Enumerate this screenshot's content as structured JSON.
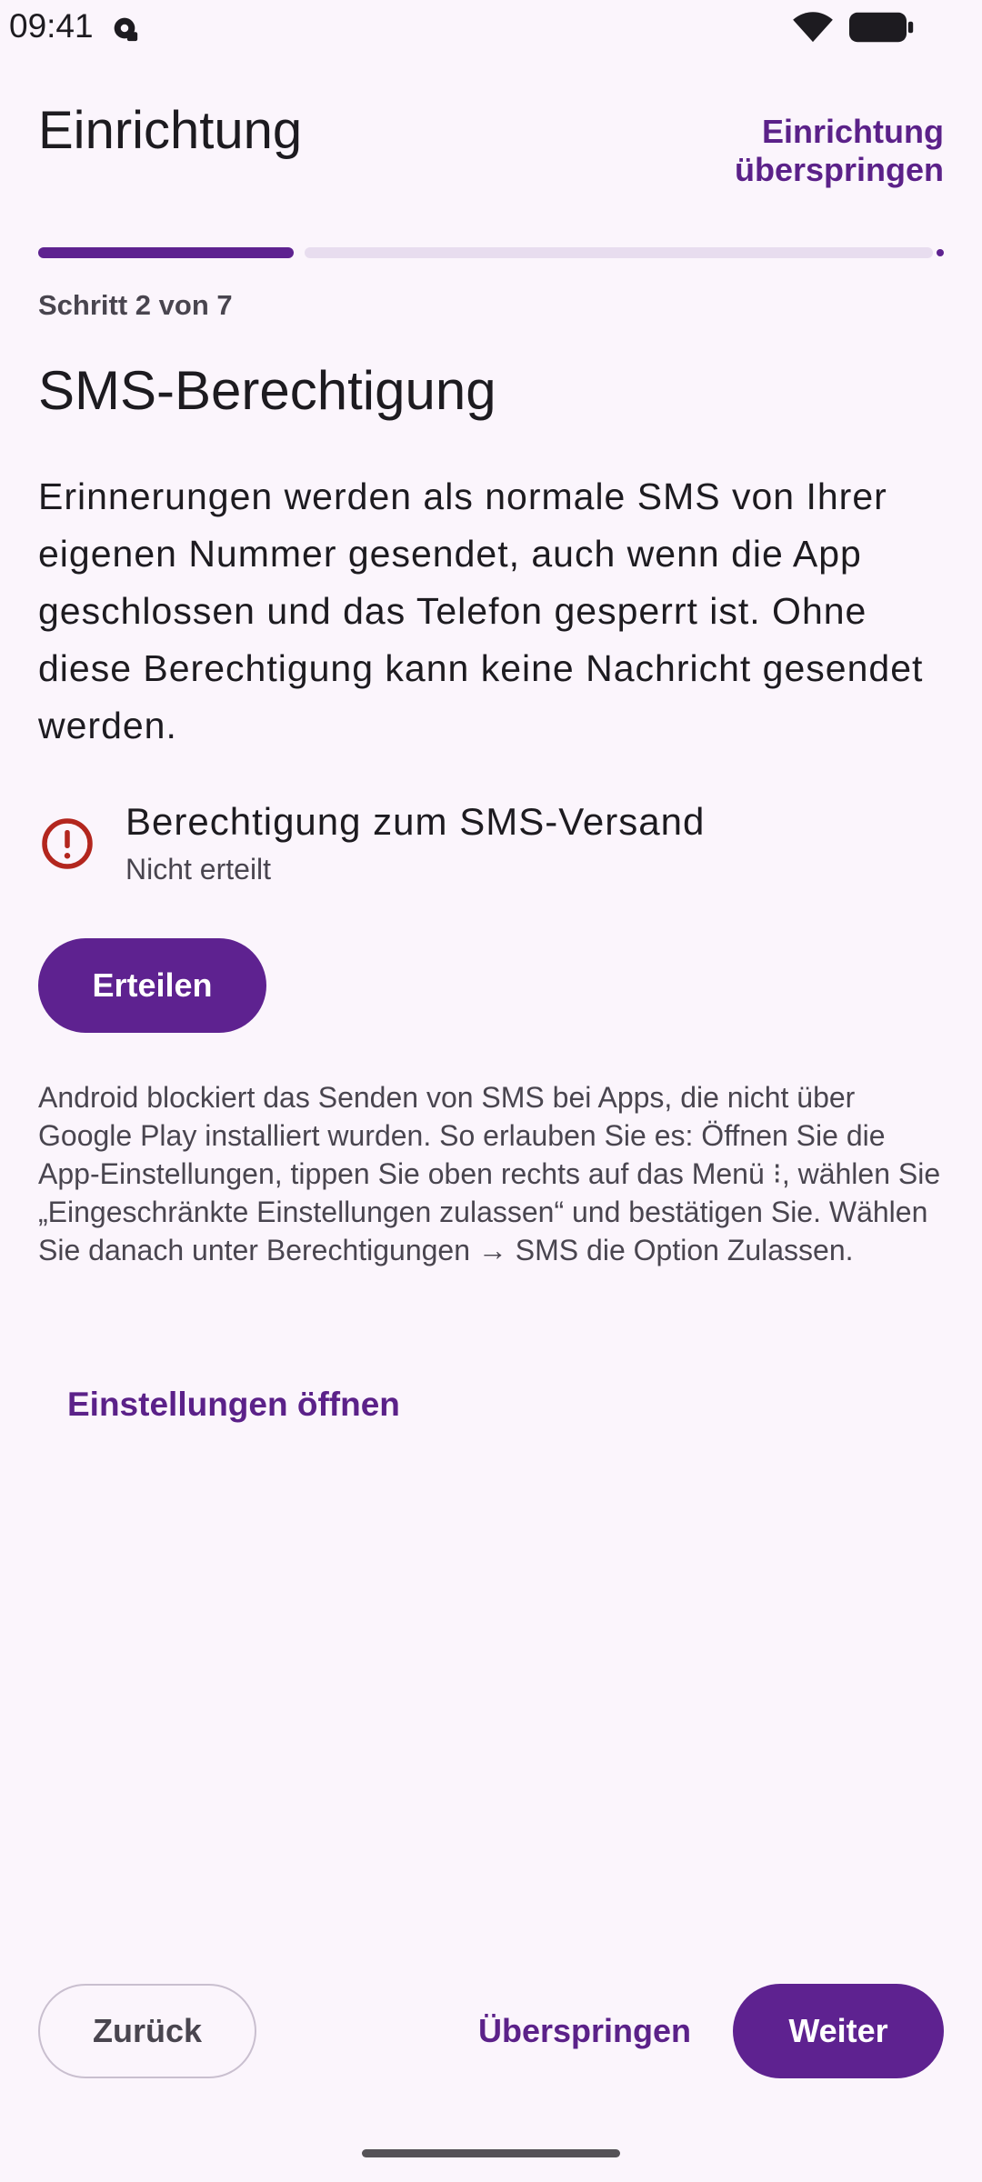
{
  "status_bar": {
    "time": "09:41",
    "icons": [
      "notification-icon",
      "wifi-icon",
      "battery-icon"
    ]
  },
  "header": {
    "title": "Einrichtung",
    "skip_setup_label": "Einrichtung überspringen"
  },
  "progress": {
    "step_label": "Schritt 2 von 7",
    "current_step": 2,
    "total_steps": 7
  },
  "section": {
    "title": "SMS-Berechtigung",
    "body": "Erinnerungen werden als normale SMS von Ihrer eigenen Nummer gesendet, auch wenn die App geschlossen und das Telefon gesperrt ist. Ohne diese Berechtigung kann keine Nachricht gesendet werden."
  },
  "permission": {
    "icon": "error-icon",
    "title": "Berechtigung zum SMS-Versand",
    "status": "Nicht erteilt",
    "grant_label": "Erteilen"
  },
  "hint": {
    "text": "Android blockiert das Senden von SMS bei Apps, die nicht über Google Play installiert wurden. So erlauben Sie es: Öffnen Sie die App-Einstellungen, tippen Sie oben rechts auf das Menü ⁝, wählen Sie „Eingeschränkte Einstellungen zulassen“ und bestätigen Sie. Wählen Sie danach unter Berechtigungen → SMS die Option Zulassen.",
    "open_settings_label": "Einstellungen öffnen"
  },
  "footer": {
    "back_label": "Zurück",
    "skip_label": "Überspringen",
    "next_label": "Weiter"
  },
  "colors": {
    "background": "#FBF5FC",
    "primary": "#5E2290",
    "error": "#B3261E",
    "track": "#E8DDEF"
  }
}
